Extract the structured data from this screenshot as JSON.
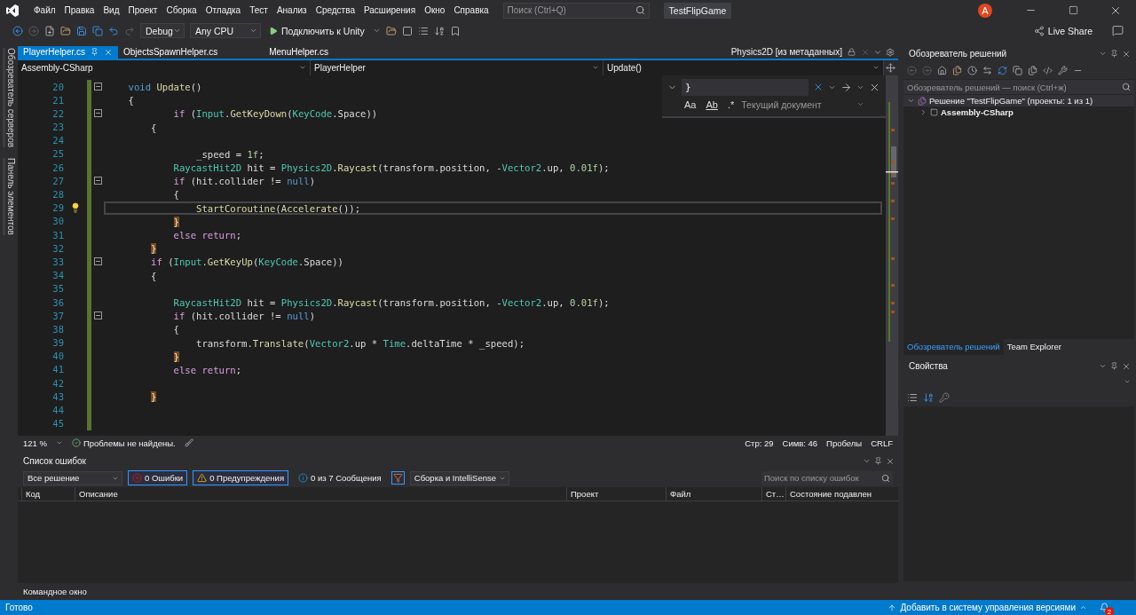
{
  "title_bar": {
    "menu": [
      "Файл",
      "Правка",
      "Вид",
      "Проект",
      "Сборка",
      "Отладка",
      "Тест",
      "Анализ",
      "Средства",
      "Расширения",
      "Окно",
      "Справка"
    ],
    "search": {
      "placeholder": "Поиск (Ctrl+Q)"
    },
    "solution_name": "TestFlipGame",
    "avatar": "A"
  },
  "toolbar": {
    "configuration": "Debug",
    "platform": "Any CPU",
    "run_label": "Подключить к Unity",
    "live_share": "Live Share"
  },
  "side_tabs": [
    "Обозреватель серверов",
    "Панель элементов"
  ],
  "editor": {
    "tabs": [
      {
        "label": "PlayerHelper.cs",
        "selected": true
      },
      {
        "label": "ObjectsSpawnHelper.cs",
        "selected": false
      },
      {
        "label": "MenuHelper.cs",
        "selected": false
      }
    ],
    "preview_tab": "Physics2D [из метаданных]",
    "nav": {
      "project": "Assembly-CSharp",
      "type": "PlayerHelper",
      "member": "Update()"
    },
    "find": {
      "query": "}",
      "scope": "Текущий документ",
      "options": [
        {
          "label": "Aa",
          "selected": false
        },
        {
          "label": "Ab",
          "selected": false
        },
        {
          "label": ".*",
          "selected": false
        }
      ]
    },
    "lines": [
      {
        "n": "20",
        "current": false,
        "hint": false,
        "fold": true,
        "tokens": [
          {
            "kind": "kw",
            "text": "    void "
          },
          {
            "kind": "method",
            "text": "Update"
          },
          {
            "kind": "plain",
            "text": "()"
          }
        ]
      },
      {
        "n": "21",
        "current": false,
        "hint": false,
        "fold": false,
        "tokens": [
          {
            "kind": "plain",
            "text": "    {"
          }
        ]
      },
      {
        "n": "22",
        "current": false,
        "hint": false,
        "fold": true,
        "tokens": [
          {
            "kind": "ctrl",
            "text": "            if"
          },
          {
            "kind": "plain",
            "text": " ("
          },
          {
            "kind": "type",
            "text": "Input"
          },
          {
            "kind": "plain",
            "text": "."
          },
          {
            "kind": "method",
            "text": "GetKeyDown"
          },
          {
            "kind": "plain",
            "text": "("
          },
          {
            "kind": "type",
            "text": "KeyCode"
          },
          {
            "kind": "plain",
            "text": ".Space))"
          }
        ]
      },
      {
        "n": "23",
        "current": false,
        "hint": false,
        "fold": false,
        "tokens": [
          {
            "kind": "plain",
            "text": "        {"
          }
        ]
      },
      {
        "n": "24",
        "current": false,
        "hint": false,
        "fold": false
      },
      {
        "n": "25",
        "current": false,
        "hint": false,
        "fold": false,
        "tokens": [
          {
            "kind": "plain",
            "text": "                _speed = "
          },
          {
            "kind": "num",
            "text": "1f"
          },
          {
            "kind": "plain",
            "text": ";"
          }
        ]
      },
      {
        "n": "26",
        "current": false,
        "hint": false,
        "fold": false,
        "tokens": [
          {
            "kind": "type",
            "text": "            RaycastHit2D"
          },
          {
            "kind": "plain",
            "text": " hit = "
          },
          {
            "kind": "type",
            "text": "Physics2D"
          },
          {
            "kind": "plain",
            "text": "."
          },
          {
            "kind": "method",
            "text": "Raycast"
          },
          {
            "kind": "plain",
            "text": "(transform.position, -"
          },
          {
            "kind": "type",
            "text": "Vector2"
          },
          {
            "kind": "plain",
            "text": ".up, "
          },
          {
            "kind": "num",
            "text": "0.01f"
          },
          {
            "kind": "plain",
            "text": ");"
          }
        ]
      },
      {
        "n": "27",
        "current": false,
        "hint": false,
        "fold": true,
        "tokens": [
          {
            "kind": "ctrl",
            "text": "            if"
          },
          {
            "kind": "plain",
            "text": " (hit.collider != "
          },
          {
            "kind": "kw",
            "text": "null"
          },
          {
            "kind": "plain",
            "text": ")"
          }
        ]
      },
      {
        "n": "28",
        "current": false,
        "hint": false,
        "fold": false,
        "tokens": [
          {
            "kind": "plain",
            "text": "            {"
          }
        ]
      },
      {
        "n": "29",
        "current": true,
        "hint": true,
        "fold": false,
        "tokens": [
          {
            "kind": "method",
            "text": "                StartCoroutine"
          },
          {
            "kind": "plain",
            "text": "("
          },
          {
            "kind": "method",
            "text": "Accelerate"
          },
          {
            "kind": "plain",
            "text": "());"
          }
        ]
      },
      {
        "n": "30",
        "current": false,
        "hint": false,
        "fold": false,
        "tokens": [
          {
            "kind": "match",
            "text": "            }"
          }
        ]
      },
      {
        "n": "31",
        "current": false,
        "hint": false,
        "fold": false,
        "tokens": [
          {
            "kind": "ctrl",
            "text": "            else return"
          },
          {
            "kind": "plain",
            "text": ";"
          }
        ]
      },
      {
        "n": "32",
        "current": false,
        "hint": false,
        "fold": false,
        "tokens": [
          {
            "kind": "match",
            "text": "        }"
          }
        ]
      },
      {
        "n": "33",
        "current": false,
        "hint": false,
        "fold": true,
        "tokens": [
          {
            "kind": "ctrl",
            "text": "        if"
          },
          {
            "kind": "plain",
            "text": " ("
          },
          {
            "kind": "type",
            "text": "Input"
          },
          {
            "kind": "plain",
            "text": "."
          },
          {
            "kind": "method",
            "text": "GetKeyUp"
          },
          {
            "kind": "plain",
            "text": "("
          },
          {
            "kind": "type",
            "text": "KeyCode"
          },
          {
            "kind": "plain",
            "text": ".Space))"
          }
        ]
      },
      {
        "n": "34",
        "current": false,
        "hint": false,
        "fold": false,
        "tokens": [
          {
            "kind": "plain",
            "text": "        {"
          }
        ]
      },
      {
        "n": "35",
        "current": false,
        "hint": false,
        "fold": false
      },
      {
        "n": "36",
        "current": false,
        "hint": false,
        "fold": false,
        "tokens": [
          {
            "kind": "type",
            "text": "            RaycastHit2D"
          },
          {
            "kind": "plain",
            "text": " hit = "
          },
          {
            "kind": "type",
            "text": "Physics2D"
          },
          {
            "kind": "plain",
            "text": "."
          },
          {
            "kind": "method",
            "text": "Raycast"
          },
          {
            "kind": "plain",
            "text": "(transform.position, -"
          },
          {
            "kind": "type",
            "text": "Vector2"
          },
          {
            "kind": "plain",
            "text": ".up, "
          },
          {
            "kind": "num",
            "text": "0.01f"
          },
          {
            "kind": "plain",
            "text": ");"
          }
        ]
      },
      {
        "n": "37",
        "current": false,
        "hint": false,
        "fold": true,
        "tokens": [
          {
            "kind": "ctrl",
            "text": "            if"
          },
          {
            "kind": "plain",
            "text": " (hit.collider != "
          },
          {
            "kind": "kw",
            "text": "null"
          },
          {
            "kind": "plain",
            "text": ")"
          }
        ]
      },
      {
        "n": "38",
        "current": false,
        "hint": false,
        "fold": false,
        "tokens": [
          {
            "kind": "plain",
            "text": "            {"
          }
        ]
      },
      {
        "n": "39",
        "current": false,
        "hint": false,
        "fold": false,
        "tokens": [
          {
            "kind": "plain",
            "text": "                transform."
          },
          {
            "kind": "method",
            "text": "Translate"
          },
          {
            "kind": "plain",
            "text": "("
          },
          {
            "kind": "type",
            "text": "Vector2"
          },
          {
            "kind": "plain",
            "text": ".up * "
          },
          {
            "kind": "type",
            "text": "Time"
          },
          {
            "kind": "plain",
            "text": ".deltaTime * _speed);"
          }
        ]
      },
      {
        "n": "40",
        "current": false,
        "hint": false,
        "fold": false,
        "tokens": [
          {
            "kind": "match",
            "text": "            }"
          }
        ]
      },
      {
        "n": "41",
        "current": false,
        "hint": false,
        "fold": false,
        "tokens": [
          {
            "kind": "ctrl",
            "text": "            else return"
          },
          {
            "kind": "plain",
            "text": ";"
          }
        ]
      },
      {
        "n": "42",
        "current": false,
        "hint": false,
        "fold": false
      },
      {
        "n": "43",
        "current": false,
        "hint": false,
        "fold": false,
        "tokens": [
          {
            "kind": "match",
            "text": "        }"
          }
        ]
      },
      {
        "n": "44",
        "current": false,
        "hint": false,
        "fold": false
      },
      {
        "n": "45",
        "current": false,
        "hint": false,
        "fold": false
      }
    ],
    "status": {
      "zoom": "121 %",
      "issues": "Проблемы не найдены.",
      "line": "Стр: 29",
      "column": "Симв: 46",
      "whitespace": "Пробелы",
      "line_ending": "CRLF"
    }
  },
  "error_list": {
    "title": "Список ошибок",
    "scope": "Все решение",
    "filters": [
      {
        "kind": "error",
        "label": "0 Ошибки",
        "selected": true
      },
      {
        "kind": "warning",
        "label": "0 Предупреждения",
        "selected": true
      },
      {
        "kind": "info",
        "label": "0 из 7 Сообщения",
        "selected": false
      }
    ],
    "source": "Сборка и IntelliSense",
    "search": {
      "placeholder": "Поиск по списку ошибок"
    },
    "columns": [
      "Код",
      "Описание",
      "Проект",
      "Файл",
      "Ст…",
      "Состояние подавлен"
    ]
  },
  "bottom_tabs": [
    "Командное окно"
  ],
  "solution_explorer": {
    "title": "Обозреватель решений",
    "search": {
      "placeholder": "Обозреватель решений — поиск (Ctrl+ж)"
    },
    "tree": [
      {
        "label": "Решение \"TestFlipGame\" (проекты: 1 из 1)",
        "selected": true,
        "expanded": true,
        "children": [
          {
            "label": "Assembly-CSharp",
            "selected": false,
            "expanded": false
          }
        ]
      }
    ],
    "tabs": [
      {
        "label": "Обозреватель решений",
        "selected": true
      },
      {
        "label": "Team Explorer",
        "selected": false
      }
    ]
  },
  "properties": {
    "title": "Свойства"
  },
  "status_bar": {
    "message": "Готово",
    "source_control": "Добавить в систему управления версиями",
    "notifications": "2"
  }
}
